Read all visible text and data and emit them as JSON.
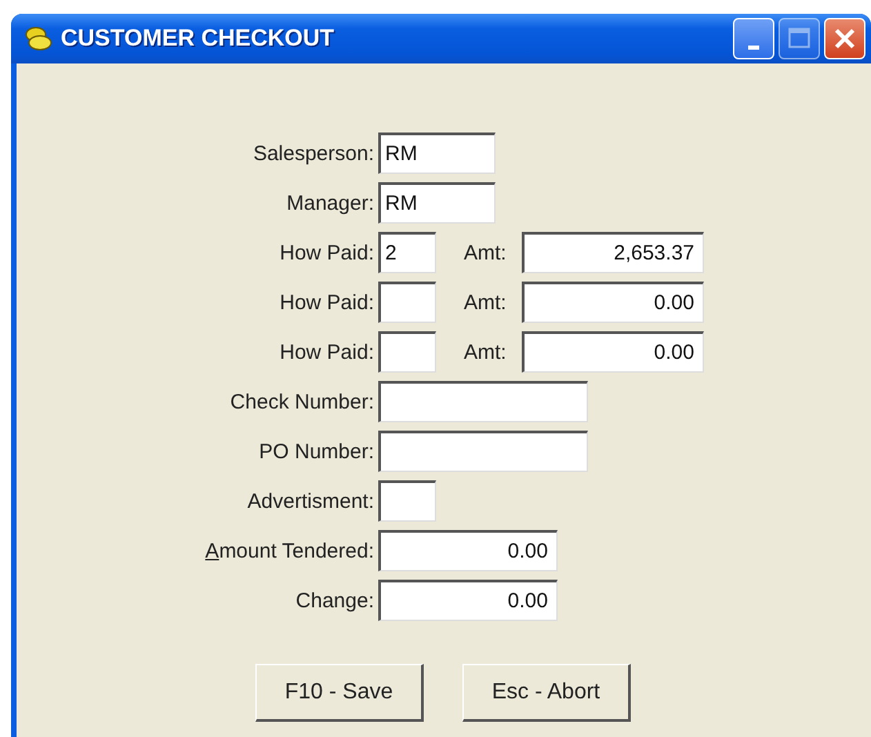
{
  "window": {
    "title": "CUSTOMER CHECKOUT"
  },
  "rows": [
    {
      "label": "Salesperson:",
      "kind": "short",
      "value": "RM"
    },
    {
      "label": "Manager:",
      "kind": "short",
      "value": "RM"
    },
    {
      "label": "How Paid:",
      "kind": "pay",
      "value": "2",
      "amt_label": "Amt:",
      "amt": "2,653.37"
    },
    {
      "label": "How Paid:",
      "kind": "pay",
      "value": "",
      "amt_label": "Amt:",
      "amt": "0.00"
    },
    {
      "label": "How Paid:",
      "kind": "pay",
      "value": "",
      "amt_label": "Amt:",
      "amt": "0.00"
    },
    {
      "label": "Check Number:",
      "kind": "wide",
      "value": ""
    },
    {
      "label": "PO Number:",
      "kind": "wide",
      "value": ""
    },
    {
      "label": "Advertisment:",
      "kind": "tiny",
      "value": ""
    },
    {
      "label": "Amount Tendered:",
      "kind": "amount",
      "value": "0.00",
      "mnemonic_first": true
    },
    {
      "label": "Change:",
      "kind": "amount",
      "value": "0.00"
    }
  ],
  "buttons": [
    "F10 - Save",
    "Esc - Abort"
  ]
}
